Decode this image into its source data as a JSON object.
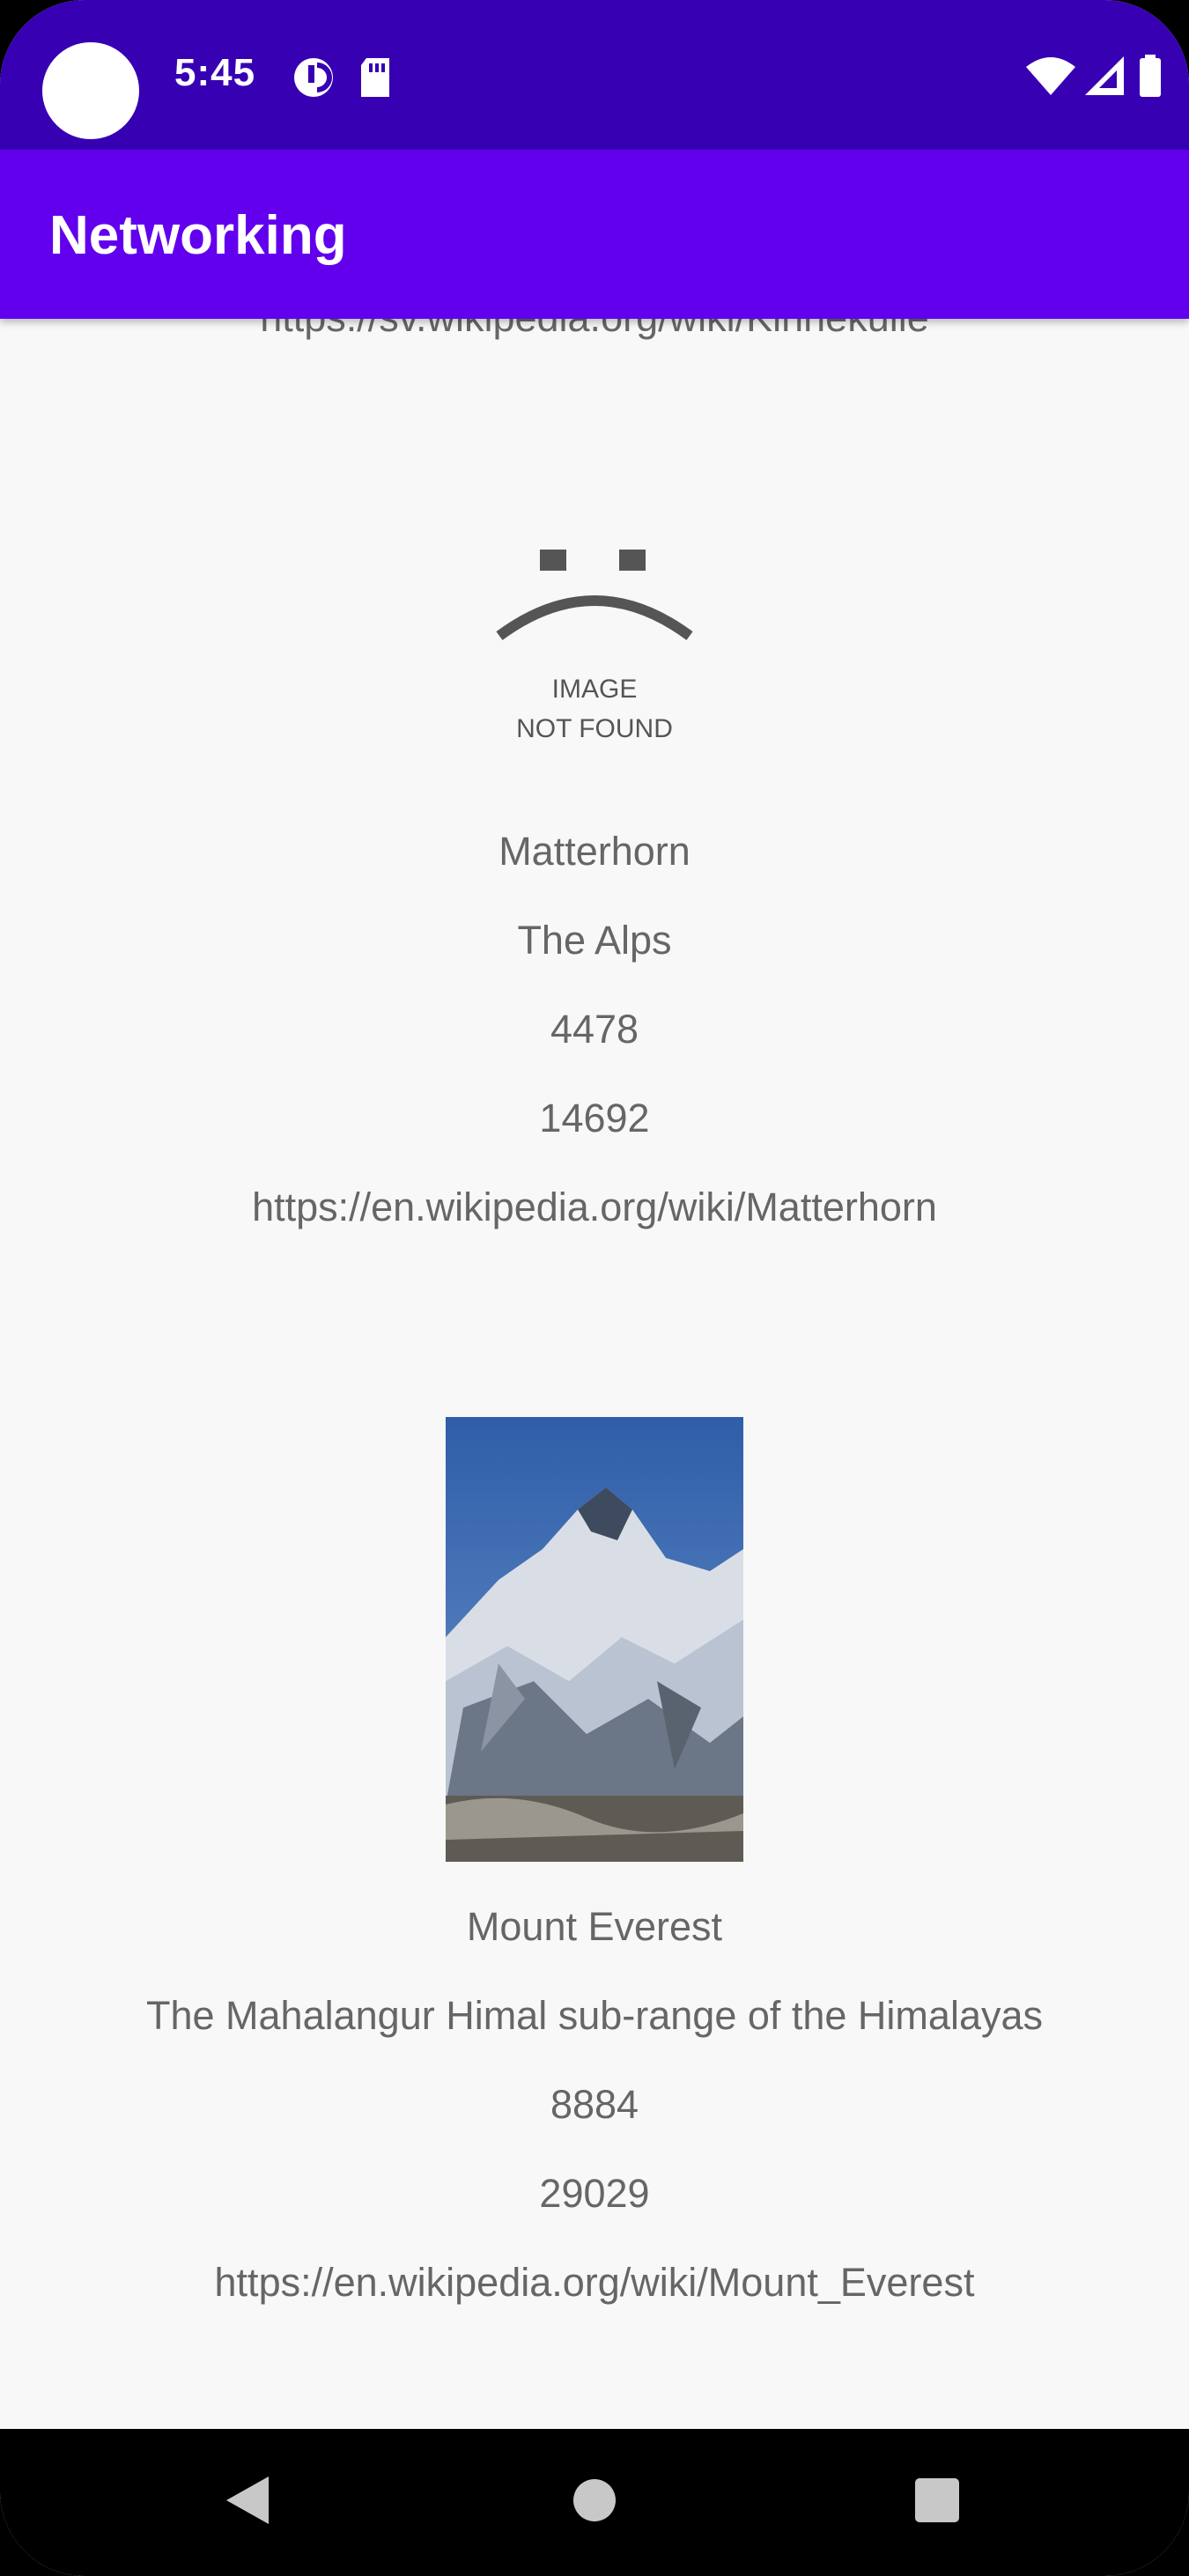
{
  "status_bar": {
    "time": "5:45",
    "left_icons": [
      "data-saver-icon",
      "sd-card-icon"
    ],
    "right_icons": [
      "wifi-icon",
      "signal-icon",
      "battery-icon"
    ]
  },
  "app_bar": {
    "title": "Networking"
  },
  "colors": {
    "status_bar": "#3700b3",
    "app_bar": "#6200ee",
    "background": "#f8f8f8",
    "text": "#666666"
  },
  "list": {
    "partial_link": "https://sv.wikipedia.org/wiki/Kinnekulle",
    "items": [
      {
        "image": "image-not-found",
        "image_text_line1": "IMAGE",
        "image_text_line2": "NOT FOUND",
        "name": "Matterhorn",
        "location": "The Alps",
        "height_m": "4478",
        "height_ft": "14692",
        "url": "https://en.wikipedia.org/wiki/Matterhorn"
      },
      {
        "image": "mount-everest-photo",
        "name": "Mount Everest",
        "location": "The Mahalangur Himal sub-range of the Himalayas",
        "height_m": "8884",
        "height_ft": "29029",
        "url": "https://en.wikipedia.org/wiki/Mount_Everest"
      }
    ]
  },
  "nav_bar": {
    "buttons": [
      "back-icon",
      "home-icon",
      "recents-icon"
    ]
  }
}
